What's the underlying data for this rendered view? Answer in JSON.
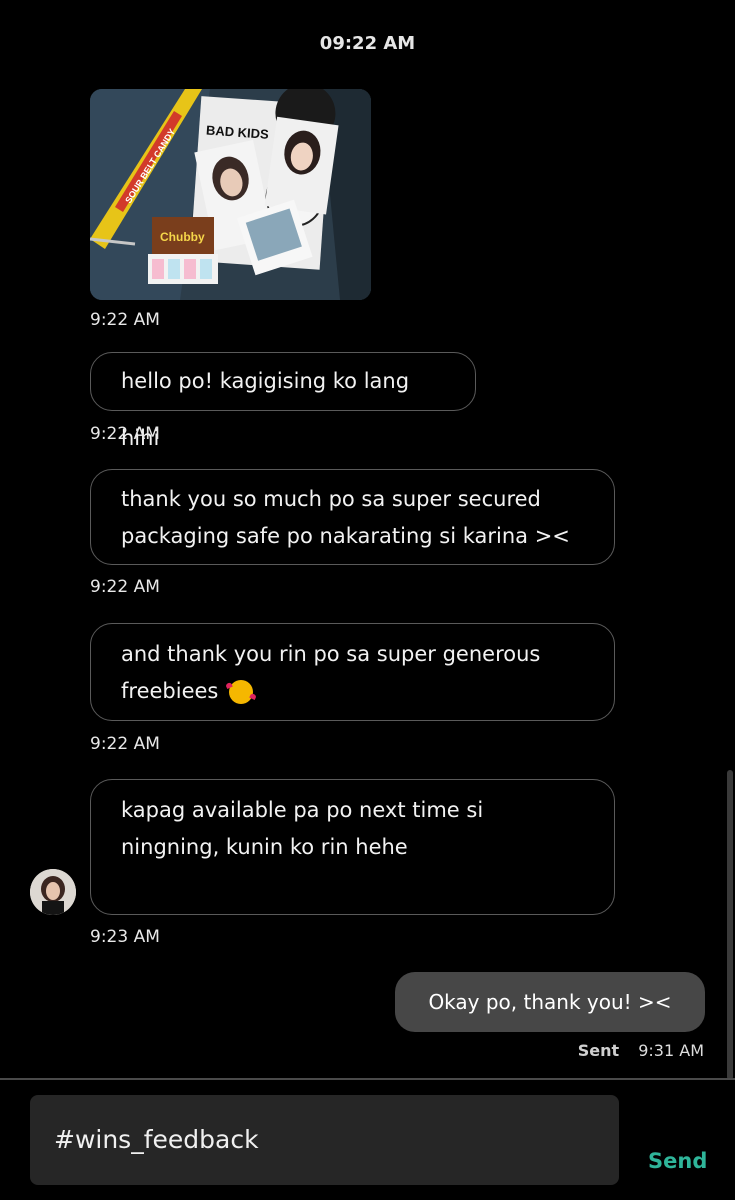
{
  "header": {
    "time": "09:22 AM"
  },
  "messages": [
    {
      "type": "image",
      "image_text": "BAD KIDS",
      "candy_text_1": "SOUR BELT CANDY",
      "candy_text_2": "Chubby",
      "time": "9:22 AM"
    },
    {
      "type": "text",
      "text": "hello po! kagigising ko lang hihi",
      "time": "9:22 AM"
    },
    {
      "type": "text",
      "text": "thank you so much po sa super secured packaging safe po nakarating si karina ><",
      "time": "9:22 AM"
    },
    {
      "type": "text",
      "text": "and thank you rin po sa super generous freebiees",
      "emoji": "smiling-face-with-hearts",
      "time": "9:22 AM"
    },
    {
      "type": "text",
      "text": "kapag available pa po next time si ningning, kunin ko rin hehe",
      "time": "9:23 AM"
    }
  ],
  "outgoing": {
    "text": "Okay po, thank you!  ><",
    "status": "Sent",
    "time": "9:31 AM"
  },
  "composer": {
    "value": "#wins_feedback",
    "send_label": "Send"
  },
  "colors": {
    "background": "#000000",
    "accent": "#2fb59a",
    "outgoing_bubble": "#474747",
    "incoming_border": "#5a5a5a"
  }
}
